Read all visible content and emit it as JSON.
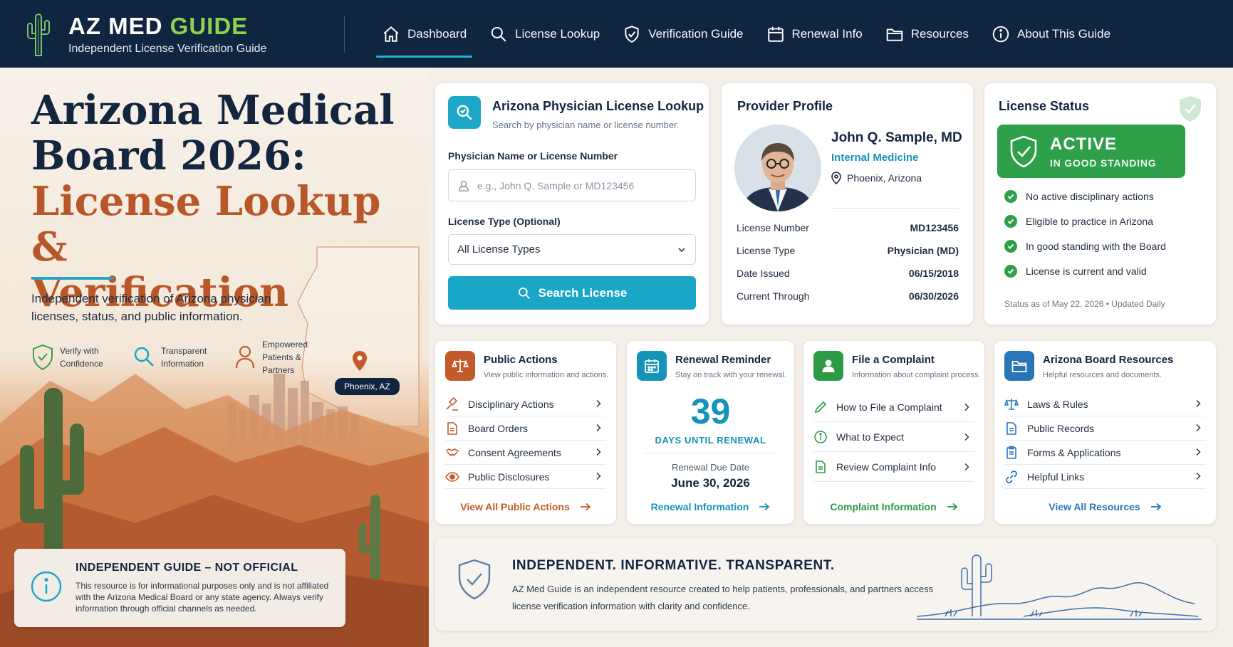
{
  "brand": {
    "title_main": "AZ MED",
    "title_accent": "GUIDE",
    "subtitle": "Independent License Verification Guide"
  },
  "nav": {
    "items": [
      {
        "label": "Dashboard",
        "icon": "home-icon",
        "active": true
      },
      {
        "label": "License Lookup",
        "icon": "search-icon"
      },
      {
        "label": "Verification Guide",
        "icon": "shield-check-icon"
      },
      {
        "label": "Renewal Info",
        "icon": "calendar-icon"
      },
      {
        "label": "Resources",
        "icon": "folder-icon"
      },
      {
        "label": "About This Guide",
        "icon": "info-icon"
      }
    ]
  },
  "hero": {
    "title_line1": "Arizona Medical",
    "title_line2": "Board 2026:",
    "title_line3": "License Lookup &",
    "title_line4": "Verification",
    "description": "Independent verification of Arizona physician licenses, status, and public information.",
    "features": [
      {
        "label": "Verify with Confidence",
        "icon": "shield-check-icon"
      },
      {
        "label": "Transparent Information",
        "icon": "magnifier-icon"
      },
      {
        "label": "Empowered Patients & Partners",
        "icon": "person-icon"
      }
    ],
    "map_label": "Phoenix, AZ"
  },
  "disclaimer": {
    "title": "INDEPENDENT GUIDE – NOT OFFICIAL",
    "text": "This resource is for informational purposes only and is not affiliated with the Arizona Medical Board or any state agency. Always verify information through official channels as needed."
  },
  "lookup": {
    "title": "Arizona Physician License Lookup",
    "subtitle": "Search by physician name or license number.",
    "name_label": "Physician Name or License Number",
    "name_placeholder": "e.g., John Q. Sample or MD123456",
    "type_label": "License Type (Optional)",
    "type_value": "All License Types",
    "button_label": "Search License"
  },
  "profile": {
    "title": "Provider Profile",
    "name": "John Q. Sample, MD",
    "specialty": "Internal Medicine",
    "location": "Phoenix, Arizona",
    "rows": [
      {
        "label": "License Number",
        "value": "MD123456"
      },
      {
        "label": "License Type",
        "value": "Physician (MD)"
      },
      {
        "label": "Date Issued",
        "value": "06/15/2018"
      },
      {
        "label": "Current Through",
        "value": "06/30/2026"
      }
    ]
  },
  "status": {
    "title": "License Status",
    "badge_main": "ACTIVE",
    "badge_sub": "IN GOOD STANDING",
    "badge_color": "#2fa04a",
    "checks": [
      "No active disciplinary actions",
      "Eligible to practice in Arizona",
      "In good standing with the Board",
      "License is current and valid"
    ],
    "footer": "Status as of May 22, 2026  •  Updated Daily"
  },
  "public_actions": {
    "title": "Public Actions",
    "subtitle": "View public information and actions.",
    "items": [
      "Disciplinary Actions",
      "Board Orders",
      "Consent Agreements",
      "Public Disclosures"
    ],
    "link": "View All Public Actions",
    "color": "#c45a2a"
  },
  "renewal": {
    "title": "Renewal Reminder",
    "subtitle": "Stay on track with your renewal.",
    "days": "39",
    "days_label": "DAYS UNTIL RENEWAL",
    "due_label": "Renewal Due Date",
    "due_date": "June 30, 2026",
    "link": "Renewal Information",
    "color": "#1494b8"
  },
  "complaint": {
    "title": "File a Complaint",
    "subtitle": "Information about complaint process.",
    "items": [
      "How to File a Complaint",
      "What to Expect",
      "Review Complaint Info"
    ],
    "link": "Complaint Information",
    "color": "#2f9a46"
  },
  "resources": {
    "title": "Arizona Board Resources",
    "subtitle": "Helpful resources and documents.",
    "items": [
      "Laws & Rules",
      "Public Records",
      "Forms & Applications",
      "Helpful Links"
    ],
    "link": "View All Resources",
    "color": "#2a74b8"
  },
  "banner": {
    "title": "INDEPENDENT. INFORMATIVE. TRANSPARENT.",
    "text": "AZ Med Guide is an independent resource created to help patients, professionals, and partners access license verification information with clarity and confidence."
  }
}
